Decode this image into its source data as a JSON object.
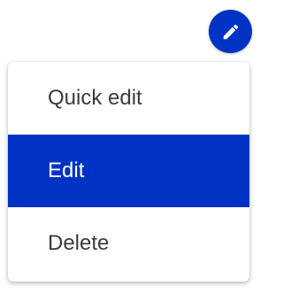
{
  "edit_fab": {
    "icon": "pencil-icon",
    "background": "#0033c4",
    "icon_color": "#ffffff"
  },
  "menu": {
    "items": [
      {
        "label": "Quick edit",
        "selected": false
      },
      {
        "label": "Edit",
        "selected": true
      },
      {
        "label": "Delete",
        "selected": false
      }
    ],
    "selected_background": "#0033c4",
    "selected_text_color": "#ffffff",
    "text_color": "#3b3b3b"
  }
}
